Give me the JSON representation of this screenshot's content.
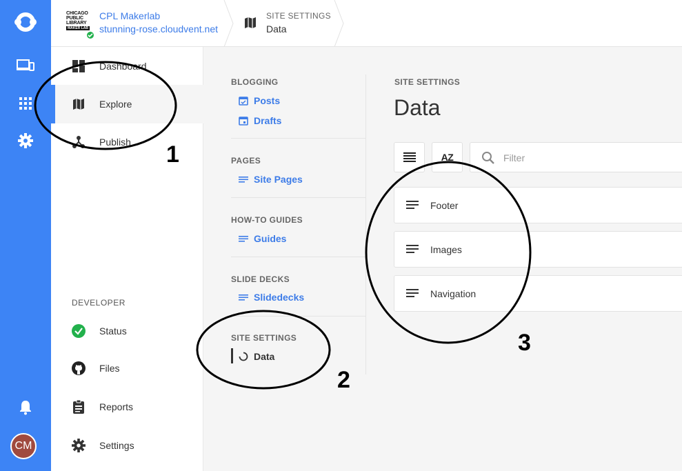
{
  "rail": {
    "items": [
      "logo-icon",
      "devices-icon",
      "apps-grid-icon",
      "gear-icon"
    ],
    "bottom": [
      "bell-icon"
    ],
    "avatar_initials": "CM",
    "accent": "#3d84f5"
  },
  "topbar": {
    "logo_lines": [
      "CHICAGO",
      "PUBLIC",
      "LIBRARY"
    ],
    "logo_sub": "MAKER LAB",
    "site_name": "CPL Makerlab",
    "site_url": "stunning-rose.cloudvent.net",
    "crumb_label": "SITE SETTINGS",
    "crumb_value": "Data"
  },
  "nav": {
    "items": [
      {
        "label": "Dashboard",
        "icon": "dashboard-icon"
      },
      {
        "label": "Explore",
        "icon": "map-icon"
      },
      {
        "label": "Publish",
        "icon": "publish-icon"
      }
    ],
    "developer_heading": "DEVELOPER",
    "developer_items": [
      {
        "label": "Status",
        "icon": "status-check-icon"
      },
      {
        "label": "Files",
        "icon": "github-icon"
      },
      {
        "label": "Reports",
        "icon": "clipboard-icon"
      },
      {
        "label": "Settings",
        "icon": "gear-icon"
      }
    ]
  },
  "submenu": {
    "groups": [
      {
        "heading": "BLOGGING",
        "links": [
          "Posts",
          "Drafts"
        ]
      },
      {
        "heading": "PAGES",
        "links": [
          "Site Pages"
        ]
      },
      {
        "heading": "HOW-TO GUIDES",
        "links": [
          "Guides"
        ]
      },
      {
        "heading": "SLIDE DECKS",
        "links": [
          "Slidedecks"
        ]
      },
      {
        "heading": "SITE SETTINGS",
        "links": [
          "Data"
        ]
      }
    ]
  },
  "main": {
    "label": "SITE SETTINGS",
    "title": "Data",
    "filter_placeholder": "Filter",
    "sort_label": "AZ",
    "rows": [
      "Footer",
      "Images",
      "Navigation"
    ]
  },
  "annotations": [
    "1",
    "2",
    "3"
  ]
}
